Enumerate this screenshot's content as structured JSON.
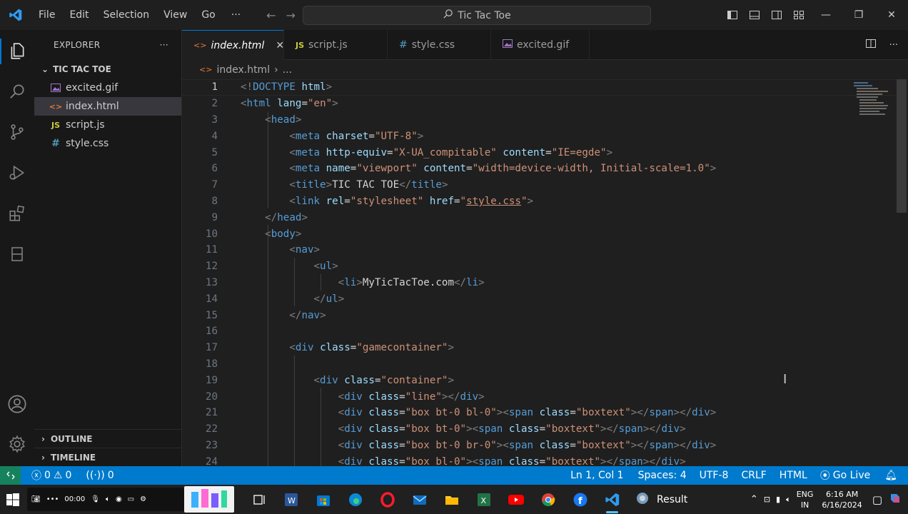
{
  "menu": [
    "File",
    "Edit",
    "Selection",
    "View",
    "Go"
  ],
  "menu_more": "···",
  "command_center": "Tic Tac Toe",
  "explorer": {
    "title": "EXPLORER",
    "more": "···",
    "folder": "TIC TAC TOE",
    "files": [
      {
        "name": "excited.gif",
        "icon": "image-file-icon"
      },
      {
        "name": "index.html",
        "icon": "html-file-icon"
      },
      {
        "name": "script.js",
        "icon": "js-file-icon"
      },
      {
        "name": "style.css",
        "icon": "css-file-icon"
      }
    ],
    "outline": "OUTLINE",
    "timeline": "TIMELINE"
  },
  "tabs": [
    {
      "label": "index.html",
      "icon": "<>"
    },
    {
      "label": "script.js",
      "icon": "JS"
    },
    {
      "label": "style.css",
      "icon": "#"
    },
    {
      "label": "excited.gif",
      "icon": "img"
    }
  ],
  "tab_close": "✕",
  "breadcrumb": {
    "file": "index.html",
    "sep": "›",
    "more": "..."
  },
  "status": {
    "errors": "0",
    "warnings": "0",
    "ports": "0",
    "position": "Ln 1, Col 1",
    "spaces": "Spaces: 4",
    "encoding": "UTF-8",
    "eol": "CRLF",
    "language": "HTML",
    "golive": "Go Live"
  },
  "taskbar": {
    "recorder_time": "00:00",
    "result_label": "Result",
    "lang_top": "ENG",
    "lang_bottom": "IN",
    "time": "6:16 AM",
    "date": "6/16/2024"
  },
  "colors": {
    "accent": "#007acc",
    "remote": "#16825d",
    "tag": "#569cd6",
    "attr": "#9cdcfe",
    "string": "#ce9178"
  }
}
